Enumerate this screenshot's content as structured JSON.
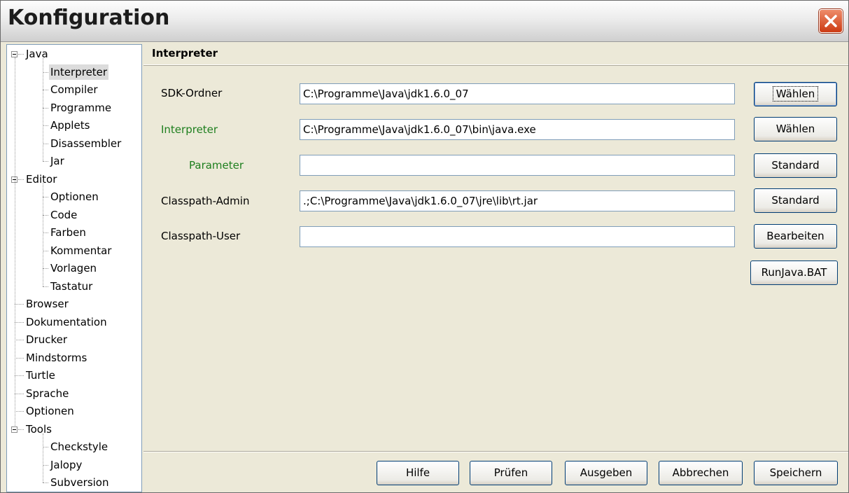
{
  "window": {
    "title": "Konfiguration"
  },
  "tree": [
    {
      "label": "Java",
      "level": 0,
      "expanded": true
    },
    {
      "label": "Interpreter",
      "level": 1,
      "selected": true
    },
    {
      "label": "Compiler",
      "level": 1
    },
    {
      "label": "Programme",
      "level": 1
    },
    {
      "label": "Applets",
      "level": 1
    },
    {
      "label": "Disassembler",
      "level": 1
    },
    {
      "label": "Jar",
      "level": 1
    },
    {
      "label": "Editor",
      "level": 0,
      "expanded": true
    },
    {
      "label": "Optionen",
      "level": 1
    },
    {
      "label": "Code",
      "level": 1
    },
    {
      "label": "Farben",
      "level": 1
    },
    {
      "label": "Kommentar",
      "level": 1
    },
    {
      "label": "Vorlagen",
      "level": 1
    },
    {
      "label": "Tastatur",
      "level": 1
    },
    {
      "label": "Browser",
      "level": 0
    },
    {
      "label": "Dokumentation",
      "level": 0
    },
    {
      "label": "Drucker",
      "level": 0
    },
    {
      "label": "Mindstorms",
      "level": 0
    },
    {
      "label": "Turtle",
      "level": 0
    },
    {
      "label": "Sprache",
      "level": 0
    },
    {
      "label": "Optionen",
      "level": 0
    },
    {
      "label": "Tools",
      "level": 0,
      "expanded": true
    },
    {
      "label": "Checkstyle",
      "level": 1
    },
    {
      "label": "Jalopy",
      "level": 1
    },
    {
      "label": "Subversion",
      "level": 1
    }
  ],
  "panel": {
    "heading": "Interpreter",
    "rows": [
      {
        "label": "SDK-Ordner",
        "value": "C:\\Programme\\Java\\jdk1.6.0_07",
        "button": "Wählen"
      },
      {
        "label": "Interpreter",
        "value": "C:\\Programme\\Java\\jdk1.6.0_07\\bin\\java.exe",
        "button": "Wählen"
      },
      {
        "label": "Parameter",
        "value": "",
        "button": "Standard"
      },
      {
        "label": "Classpath-Admin",
        "value": ".;C:\\Programme\\Java\\jdk1.6.0_07\\jre\\lib\\rt.jar",
        "button": "Standard"
      },
      {
        "label": "Classpath-User",
        "value": "",
        "button": "Bearbeiten"
      }
    ],
    "runjava_button": "RunJava.BAT"
  },
  "footer": {
    "help": "Hilfe",
    "check": "Prüfen",
    "output": "Ausgeben",
    "cancel": "Abbrechen",
    "save": "Speichern"
  },
  "colors": {
    "green_label": "#1e7f1e",
    "close_red": "#cc3a12"
  }
}
